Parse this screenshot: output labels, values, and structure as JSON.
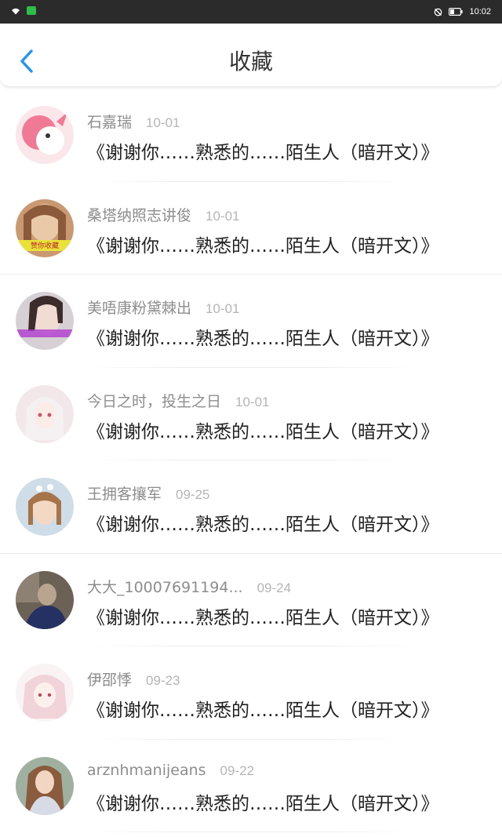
{
  "status_bar": {
    "time": "10:02"
  },
  "header": {
    "title": "收藏"
  },
  "items": [
    {
      "username": "石嘉瑞",
      "date": "10-01",
      "title": "《谢谢你……熟悉的……陌生人（暗开文）》",
      "avatar_color": "#f7a6b6"
    },
    {
      "username": "桑塔纳照志讲俊",
      "date": "10-01",
      "title": "《谢谢你……熟悉的……陌生人（暗开文）》",
      "avatar_color": "#d9a57a",
      "avatar_caption": "赞你收藏"
    },
    {
      "username": "美唔康粉黛棘出",
      "date": "10-01",
      "title": "《谢谢你……熟悉的……陌生人（暗开文）》",
      "avatar_color": "#c7b9c0"
    },
    {
      "username": "今日之时，投生之日",
      "date": "10-01",
      "title": "《谢谢你……熟悉的……陌生人（暗开文）》",
      "avatar_color": "#e9dde1"
    },
    {
      "username": "王拥客攘军",
      "date": "09-25",
      "title": "《谢谢你……熟悉的……陌生人（暗开文）》",
      "avatar_color": "#c8d6e3"
    },
    {
      "username": "大大_10007691194...",
      "date": "09-24",
      "title": "《谢谢你……熟悉的……陌生人（暗开文）》",
      "avatar_color": "#5a6475"
    },
    {
      "username": "伊邵悸",
      "date": "09-23",
      "title": "《谢谢你……熟悉的……陌生人（暗开文）》",
      "avatar_color": "#f3dfe2"
    },
    {
      "username": "arznhmanijeans",
      "date": "09-22",
      "title": "《谢谢你……熟悉的……陌生人（暗开文）》",
      "avatar_color": "#a8b7a6"
    }
  ]
}
